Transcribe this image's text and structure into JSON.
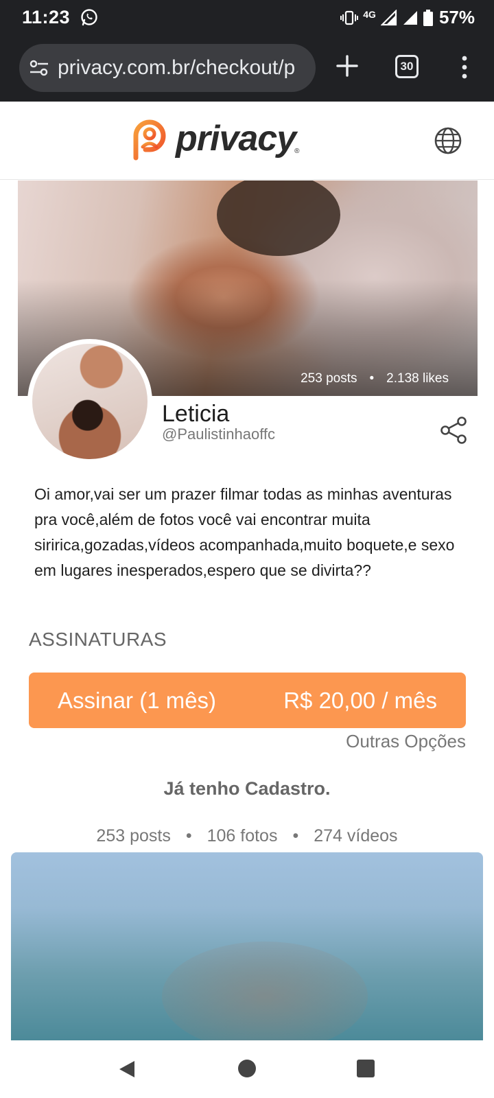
{
  "status_bar": {
    "time": "11:23",
    "network": "4G",
    "battery": "57%",
    "icons": [
      "whatsapp-icon",
      "vibrate-icon",
      "signal-icon",
      "battery-icon"
    ]
  },
  "browser": {
    "url": "privacy.com.br/checkout/p",
    "tab_count": "30",
    "icons": [
      "site-settings-icon",
      "plus-icon",
      "more-vert-icon"
    ]
  },
  "header": {
    "brand": "privacy",
    "brand_mark": "®",
    "icons": [
      "privacy-logo-icon",
      "globe-icon"
    ]
  },
  "profile": {
    "cover_posts": "253 posts",
    "cover_likes": "2.138 likes",
    "name": "Leticia",
    "handle": "@Paulistinhaoffc",
    "bio": "Oi amor,vai ser um prazer filmar todas as minhas aventuras pra você,além de fotos você vai encontrar muita siririca,gozadas,vídeos acompanhada,muito boquete,e sexo em lugares inesperados,espero que se divirta??"
  },
  "subscriptions": {
    "title": "ASSINATURAS",
    "plan_label": "Assinar (1 mês)",
    "plan_price": "R$ 20,00 / mês",
    "other_options": "Outras Opções",
    "login": "Já tenho Cadastro."
  },
  "counts": {
    "posts": "253 posts",
    "photos": "106 fotos",
    "videos": "274 vídeos"
  },
  "colors": {
    "accent": "#fc9750",
    "logo_orange": "#f2642d",
    "browser_bg": "#202124"
  }
}
